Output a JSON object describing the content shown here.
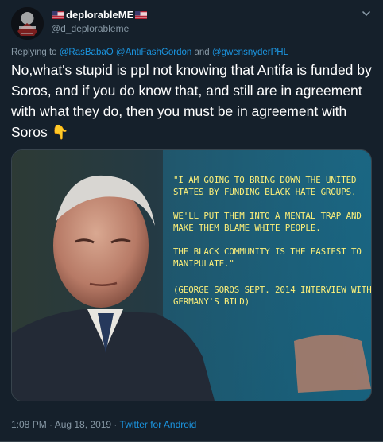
{
  "tweet": {
    "display_name": "deplorableME",
    "handle": "@d_deplorableme",
    "replying_prefix": "Replying to",
    "replying_mention_1": "@RasBabaO",
    "replying_mention_2": "@AntiFashGordon",
    "replying_and": "and",
    "replying_mention_3": "@gwensnyderPHL",
    "text": "No,what's stupid is ppl not knowing that Antifa is funded by Soros, and if you do know that, and still are in agreement with what they do, then you must be in agreement with Soros",
    "emoji": "👇",
    "timestamp": "1:08 PM · Aug 18, 2019",
    "separator": " · ",
    "source": "Twitter for Android"
  },
  "media": {
    "quote_line_1": "\"I AM GOING TO BRING DOWN THE UNITED STATES BY FUNDING BLACK HATE GROUPS.",
    "quote_line_2": "WE'LL PUT THEM INTO A MENTAL TRAP AND MAKE THEM BLAME WHITE PEOPLE.",
    "quote_line_3": "THE BLACK COMMUNITY IS THE EASIEST TO MANIPULATE.\"",
    "attribution": "(GEORGE SOROS SEPT. 2014 INTERVIEW WITH GERMANY'S BILD)"
  },
  "colors": {
    "background": "#15202b",
    "link": "#1b95e0",
    "muted": "#8899a6",
    "quote_text": "#fdf07a"
  }
}
